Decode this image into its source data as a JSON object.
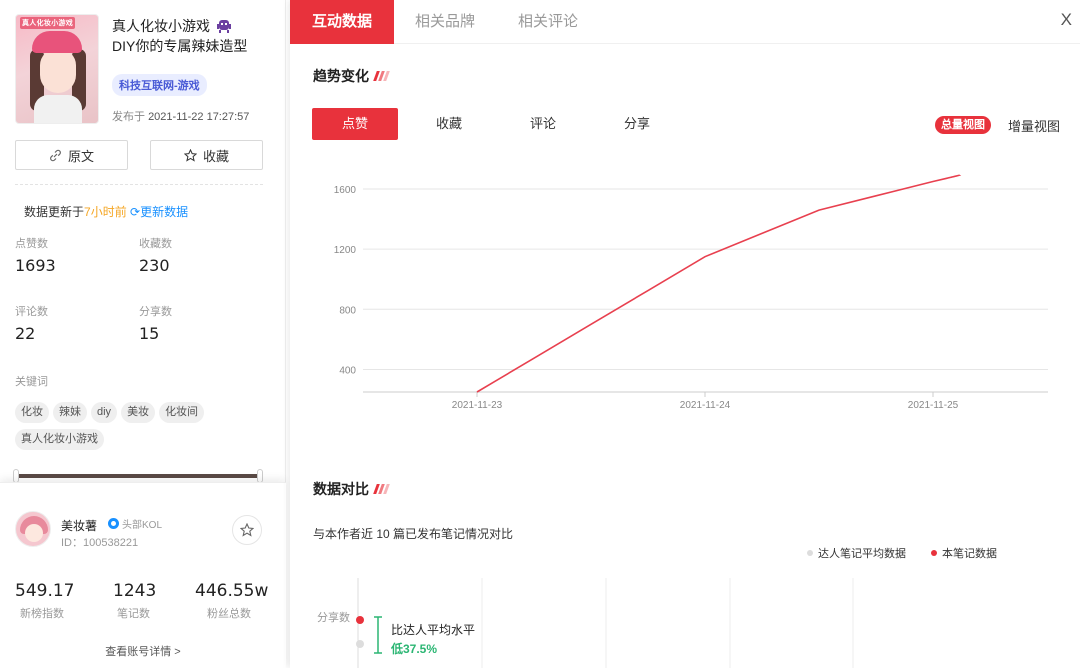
{
  "note": {
    "cover_text": "真人化妆小游戏",
    "title_line1": "真人化妆小游戏",
    "title_line2": "DIY你的专属辣妹造型",
    "category_tag": "科技互联网-游戏",
    "publish_label": "发布于",
    "publish_time": "2021-11-22 17:27:57",
    "source_button": "原文",
    "favorite_button": "收藏"
  },
  "update": {
    "prefix": "数据更新于",
    "ago": "7小时前",
    "refresh_label": "更新数据"
  },
  "stats": [
    {
      "label": "点赞数",
      "value": "1693"
    },
    {
      "label": "收藏数",
      "value": "230"
    },
    {
      "label": "评论数",
      "value": "22"
    },
    {
      "label": "分享数",
      "value": "15"
    }
  ],
  "keywords": {
    "label": "关键词",
    "items": [
      "化妆",
      "辣妹",
      "diy",
      "美妆",
      "化妆间",
      "真人化妆小游戏"
    ]
  },
  "author": {
    "name": "美妆薯",
    "kol_label": "头部KOL",
    "id_text": "ID：100538221",
    "metrics": [
      {
        "value": "549.17",
        "label": "新榜指数"
      },
      {
        "value": "1243",
        "label": "笔记数"
      },
      {
        "value": "446.55w",
        "label": "粉丝总数"
      }
    ],
    "detail_link": "查看账号详情 >"
  },
  "tabs": [
    "互动数据",
    "相关品牌",
    "相关评论"
  ],
  "close_label": "X",
  "trend": {
    "section_title": "趋势变化",
    "subtabs": [
      "点赞",
      "收藏",
      "评论",
      "分享"
    ],
    "active_subtab": 0,
    "view_total": "总量视图",
    "view_increment": "增量视图"
  },
  "compare": {
    "section_title": "数据对比",
    "description": "与本作者近 10 篇已发布笔记情况对比",
    "legend_avg": "达人笔记平均数据",
    "legend_this": "本笔记数据",
    "row_label": "分享数",
    "note_line1": "比达人平均水平",
    "note_line2": "低37.5%"
  },
  "colors": {
    "accent": "#e8323c",
    "line": "#e8404f",
    "positive": "#2bb673",
    "link": "#1890ff",
    "warning": "#f5a623"
  },
  "chart_data": {
    "type": "line",
    "title": "",
    "xlabel": "",
    "ylabel": "",
    "x": [
      "2021-11-23",
      "2021-11-24",
      "2021-11-25"
    ],
    "ylim": [
      250,
      1700
    ],
    "yticks": [
      400,
      800,
      1200,
      1600
    ],
    "series": [
      {
        "values": [
          {
            "x": 0.0,
            "y": 250
          },
          {
            "x": 0.5,
            "y": 700
          },
          {
            "x": 1.0,
            "y": 1150
          },
          {
            "x": 1.5,
            "y": 1460
          },
          {
            "x": 2.0,
            "y": 1650
          },
          {
            "x": 2.12,
            "y": 1693
          }
        ]
      }
    ],
    "grid": true,
    "legend": "none"
  }
}
